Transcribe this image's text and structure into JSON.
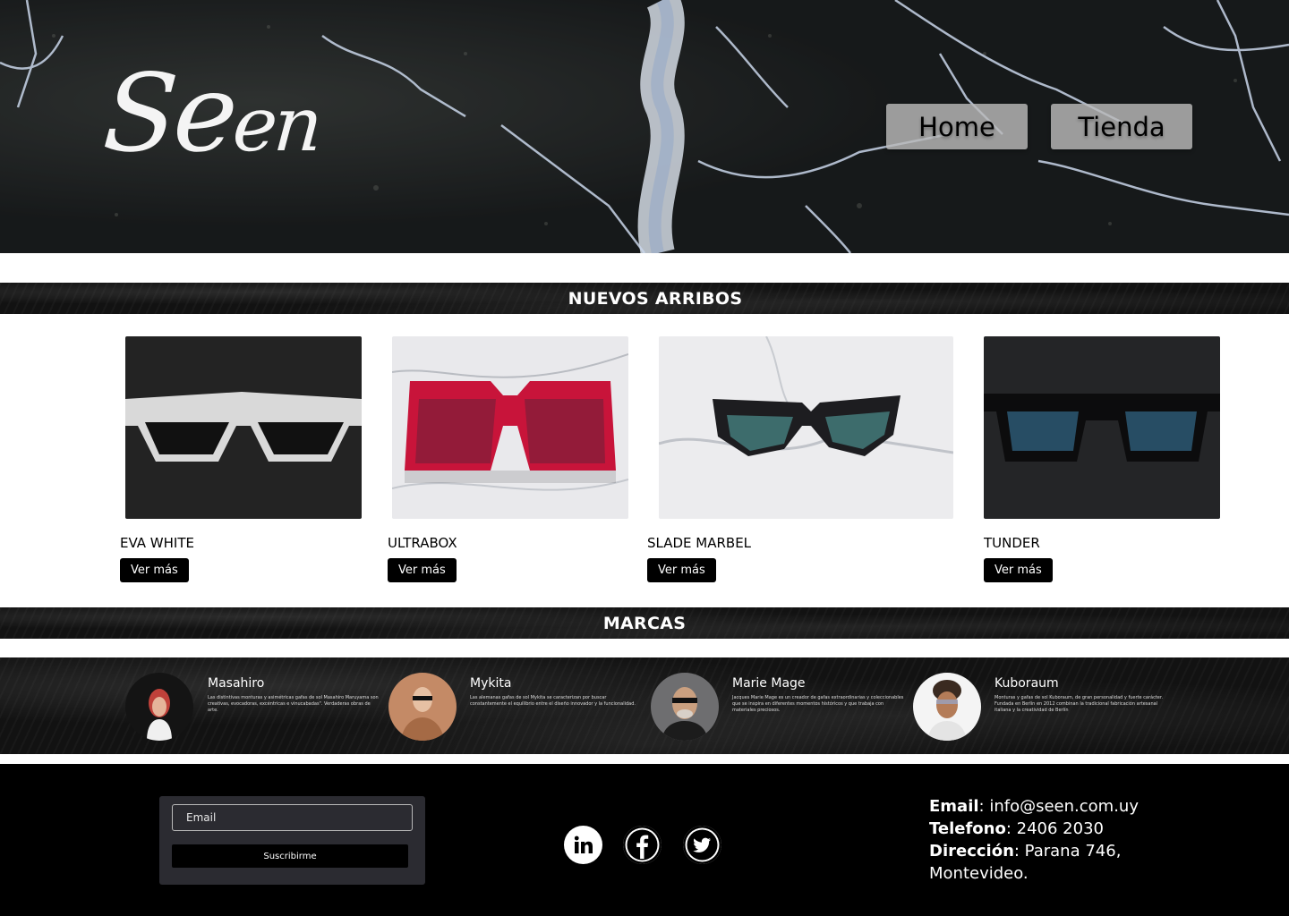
{
  "header": {
    "logo_main": "Se",
    "logo_small": "en",
    "nav": [
      {
        "label": "Home"
      },
      {
        "label": "Tienda"
      }
    ]
  },
  "sections": {
    "arrivals_title": "NUEVOS ARRIBOS",
    "brands_title": "MARCAS"
  },
  "products": [
    {
      "name": "EVA WHITE",
      "button": "Ver más"
    },
    {
      "name": "ULTRABOX",
      "button": "Ver más"
    },
    {
      "name": "SLADE MARBEL",
      "button": "Ver más"
    },
    {
      "name": "TUNDER",
      "button": "Ver más"
    }
  ],
  "brands": [
    {
      "name": "Masahiro",
      "description": "Las distintivas monturas y asimétricas gafas de sol Masahiro Maruyama son creativas, evocadoras, excéntricas e vinucabadas\". Verdaderas obras de arte."
    },
    {
      "name": "Mykita",
      "description": "Las alemanas gafas de sol Mykita se caracterizan por buscar constantemente el equilibrio entre el diseño innovador y la funcionalidad."
    },
    {
      "name": "Marie Mage",
      "description": "Jacques Marie Mage es un creador de gafas extraordinarias y coleccionables que se inspira en diferentes momentos históricos y que trabaja con materiales preciosos."
    },
    {
      "name": "Kuboraum",
      "description": "Monturas y gafas de sol Kuboraum, de gran personalidad y fuerte carácter. Fundada en Berlín en 2012 combinan la tradicional fabricación artesanal italiana y la creatividad de Berlín"
    }
  ],
  "footer": {
    "email_placeholder": "Email",
    "subscribe_label": "Suscribirme",
    "social": [
      "linkedin-icon",
      "facebook-icon",
      "twitter-icon"
    ],
    "contact": {
      "email_label": "Email",
      "email_value": ": info@seen.com.uy",
      "phone_label": "Telefono",
      "phone_value": ": 2406 2030",
      "address_label": "Dirección",
      "address_value": ": Parana 746, Montevideo."
    }
  },
  "colors": {
    "dark": "#121212",
    "nav_button": "#b9b9b9",
    "footer_box": "#2b2b31"
  }
}
